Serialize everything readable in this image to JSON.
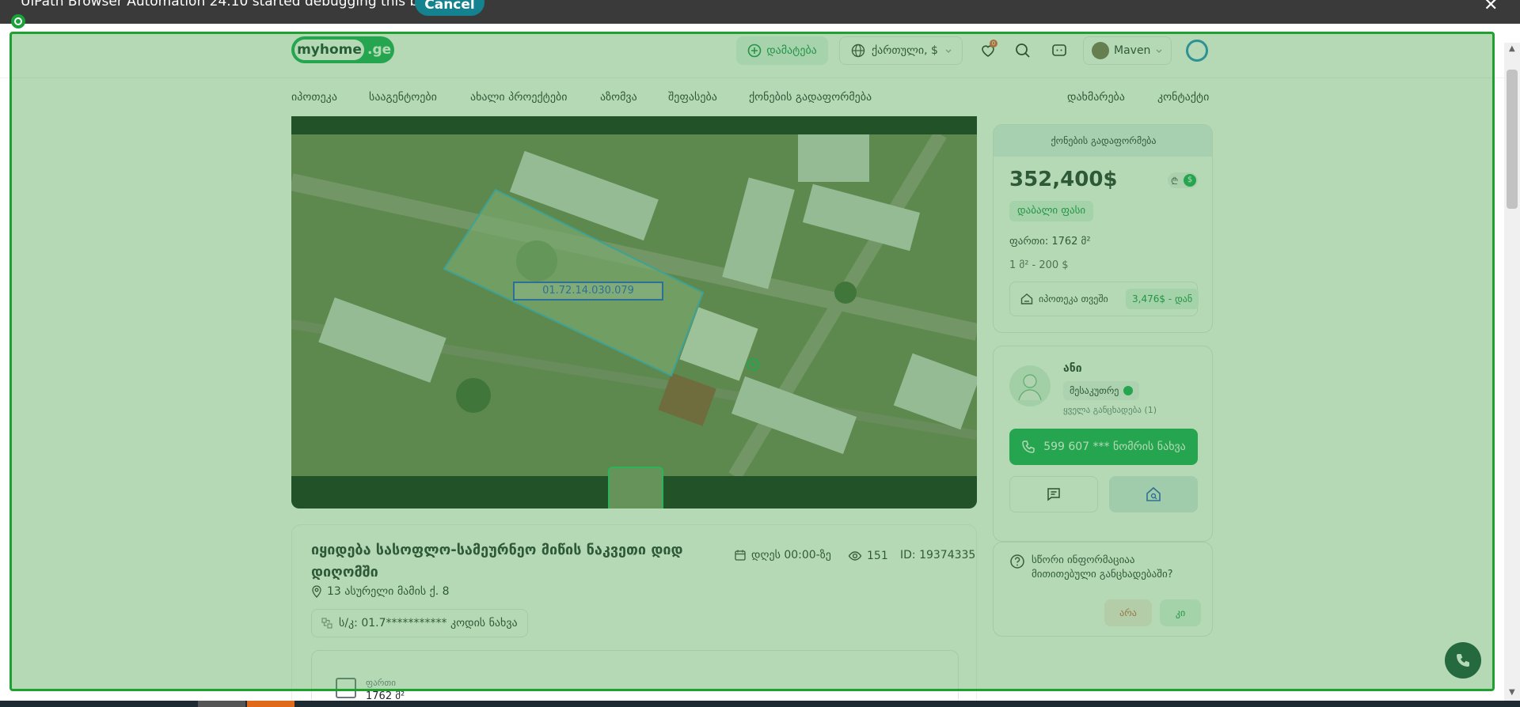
{
  "debug_bar": {
    "message": "UiPath Browser Automation 24.10 started debugging this browser",
    "cancel_label": "Cancel",
    "close_label": "✕"
  },
  "header": {
    "logo_main": "myhome",
    "logo_suffix": ".ge",
    "add_label": "დამატება",
    "language_label": "ქართული, $",
    "favorites_count": "0",
    "user_name": "Maven"
  },
  "nav": {
    "items": [
      "იპოთეკა",
      "სააგენტოები",
      "ახალი პროექტები",
      "აზომვა",
      "შეფასება",
      "ქონების გადაფორმება"
    ],
    "right_items": [
      "დახმარება",
      "კონტაქტი"
    ]
  },
  "gallery": {
    "parcel_label": "01.72.14.030.079"
  },
  "listing": {
    "title": "იყიდება სასოფლო-სამეურნეო მიწის ნაკვეთი დიდ დიღომში",
    "date": "დღეს 00:00-ზე",
    "views": "151",
    "id_label": "ID: 19374335",
    "address": "13 ასურელი მამის ქ. 8",
    "cadastral_label": "ს/კ: 01.7*********** კოდის ნახვა",
    "area_label": "ფართი",
    "area_value": "1762 მ²"
  },
  "price_card": {
    "header": "ქონების გადაფორმება",
    "price": "352,400$",
    "currency_gel": "₾",
    "currency_usd": "$",
    "badge": "დაბალი ფასი",
    "area": "ფართი: 1762 მ²",
    "per_sqm": "1 მ² - 200 $",
    "mortgage_label": "იპოთეკა თვეში",
    "mortgage_value": "3,476$ - დან"
  },
  "agent": {
    "name": "ანი",
    "role": "მესაკუთრე",
    "all_listings": "ყველა განცხადება (1)",
    "phone_label": "599 607 ***   ნომრის ნახვა"
  },
  "info_card": {
    "question": "სწორი ინფორმაციაა მითითებული განცხადებაში?",
    "no_label": "არა",
    "yes_label": "კი"
  }
}
